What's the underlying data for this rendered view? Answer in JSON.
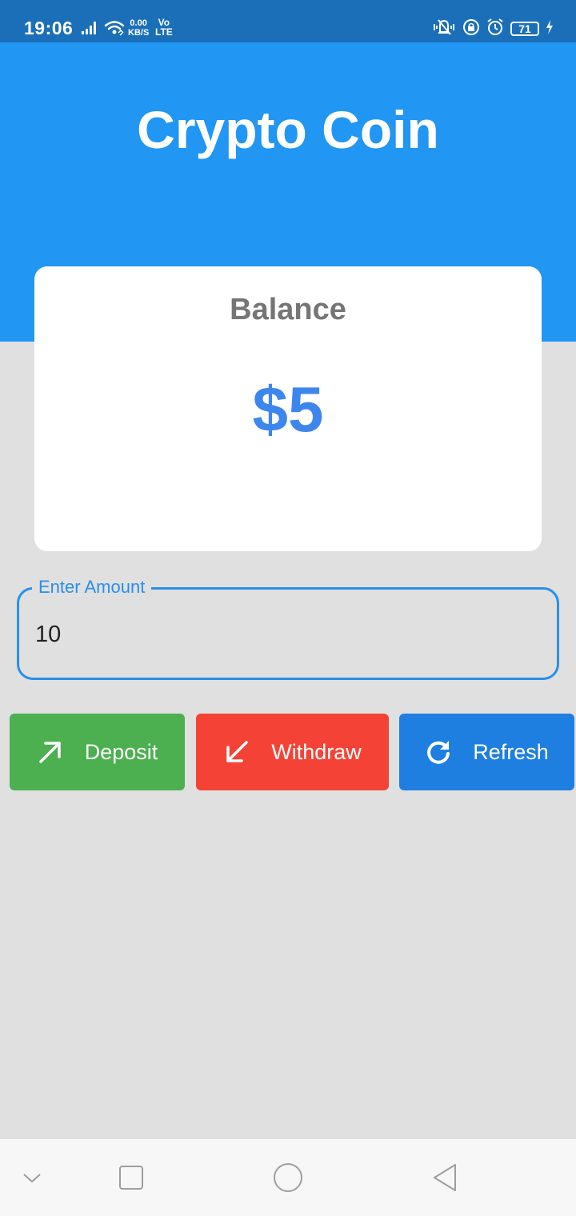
{
  "status_bar": {
    "time": "19:06",
    "speed_value": "0.00",
    "speed_unit": "KB/S",
    "volte_top": "Vo",
    "volte_bottom": "LTE",
    "battery": "71",
    "icons": [
      "signal-icon",
      "wifi-icon",
      "vibrate-icon",
      "lock-rotation-icon",
      "alarm-icon",
      "battery-icon",
      "charging-icon"
    ]
  },
  "header": {
    "title": "Crypto Coin"
  },
  "balance": {
    "label": "Balance",
    "value": "$5"
  },
  "amount_field": {
    "label": "Enter Amount",
    "value": "10"
  },
  "actions": {
    "deposit": {
      "label": "Deposit",
      "icon": "arrow-up-right-icon"
    },
    "withdraw": {
      "label": "Withdraw",
      "icon": "arrow-down-left-icon"
    },
    "refresh": {
      "label": "Refresh",
      "icon": "refresh-icon"
    }
  },
  "nav_bar": {
    "icons": [
      "chevron-down-icon",
      "recents-icon",
      "home-icon",
      "back-icon"
    ]
  },
  "colors": {
    "status_bar": "#1b6fb8",
    "header": "#2196f3",
    "background": "#e0e0e0",
    "balance_value": "#3d86ee",
    "field_border": "#2a8fe8",
    "deposit": "#4caf50",
    "withdraw": "#f44336",
    "refresh": "#1e7fe0"
  }
}
